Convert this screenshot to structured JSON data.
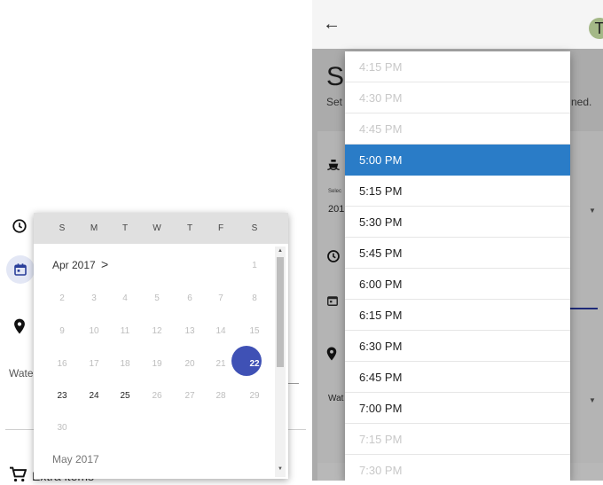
{
  "left": {
    "water_label": "Wate",
    "extra_items_label": "Extra items",
    "calendar": {
      "weekdays": [
        "S",
        "M",
        "T",
        "W",
        "T",
        "F",
        "S"
      ],
      "current_month": "Apr 2017",
      "current_month_chevron": ">",
      "next_month": "May 2017",
      "days": [
        {
          "d": "1",
          "state": "disabled"
        },
        {
          "d": "2",
          "state": "disabled"
        },
        {
          "d": "3",
          "state": "disabled"
        },
        {
          "d": "4",
          "state": "disabled"
        },
        {
          "d": "5",
          "state": "disabled"
        },
        {
          "d": "6",
          "state": "disabled"
        },
        {
          "d": "7",
          "state": "disabled"
        },
        {
          "d": "8",
          "state": "disabled"
        },
        {
          "d": "9",
          "state": "disabled"
        },
        {
          "d": "10",
          "state": "disabled"
        },
        {
          "d": "11",
          "state": "disabled"
        },
        {
          "d": "12",
          "state": "disabled"
        },
        {
          "d": "13",
          "state": "disabled"
        },
        {
          "d": "14",
          "state": "disabled"
        },
        {
          "d": "15",
          "state": "disabled"
        },
        {
          "d": "16",
          "state": "disabled"
        },
        {
          "d": "17",
          "state": "disabled"
        },
        {
          "d": "18",
          "state": "disabled"
        },
        {
          "d": "19",
          "state": "disabled"
        },
        {
          "d": "20",
          "state": "disabled"
        },
        {
          "d": "21",
          "state": "disabled"
        },
        {
          "d": "22",
          "state": "selected"
        },
        {
          "d": "23",
          "state": "enabled"
        },
        {
          "d": "24",
          "state": "enabled"
        },
        {
          "d": "25",
          "state": "enabled"
        },
        {
          "d": "26",
          "state": "disabled"
        },
        {
          "d": "27",
          "state": "disabled"
        },
        {
          "d": "28",
          "state": "disabled"
        },
        {
          "d": "29",
          "state": "disabled"
        },
        {
          "d": "30",
          "state": "disabled"
        }
      ],
      "selected_color": "#3f51b5"
    }
  },
  "right": {
    "back_icon": "arrow-left-icon",
    "avatar_letter": "T",
    "title_fragment": "So",
    "subtitle_fragment": "Set",
    "subtitle_end_fragment": "ned.",
    "select_label_fragment": "Selec",
    "year_fragment": "201",
    "water_fragment": "Wat",
    "time_options": [
      {
        "label": "4:15 PM",
        "state": "disabled"
      },
      {
        "label": "4:30 PM",
        "state": "disabled"
      },
      {
        "label": "4:45 PM",
        "state": "disabled"
      },
      {
        "label": "5:00 PM",
        "state": "selected"
      },
      {
        "label": "5:15 PM",
        "state": "enabled"
      },
      {
        "label": "5:30 PM",
        "state": "enabled"
      },
      {
        "label": "5:45 PM",
        "state": "enabled"
      },
      {
        "label": "6:00 PM",
        "state": "enabled"
      },
      {
        "label": "6:15 PM",
        "state": "enabled"
      },
      {
        "label": "6:30 PM",
        "state": "enabled"
      },
      {
        "label": "6:45 PM",
        "state": "enabled"
      },
      {
        "label": "7:00 PM",
        "state": "enabled"
      },
      {
        "label": "7:15 PM",
        "state": "disabled"
      },
      {
        "label": "7:30 PM",
        "state": "disabled"
      }
    ],
    "selected_color": "#2a7cc7"
  }
}
